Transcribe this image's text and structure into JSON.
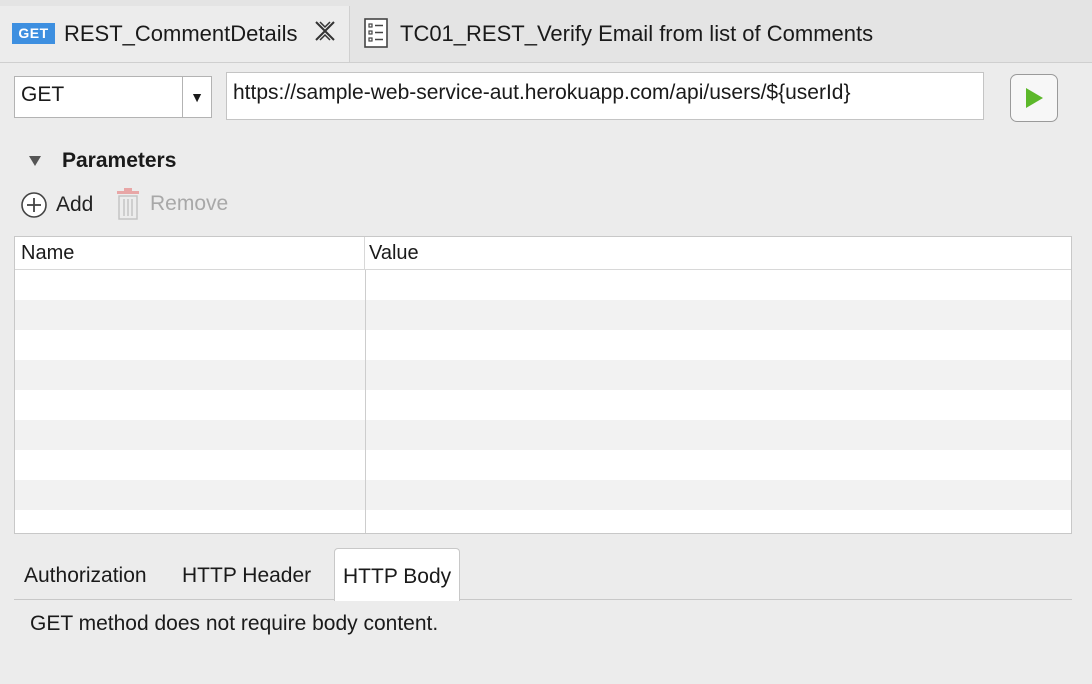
{
  "editor_tabs": [
    {
      "label": "REST_CommentDetails",
      "badge": "GET",
      "active": true,
      "icon": "get-method-icon"
    },
    {
      "label": "TC01_REST_Verify Email from list of Comments",
      "active": false,
      "icon": "test-case-icon"
    }
  ],
  "request": {
    "method": "GET",
    "url": "https://sample-web-service-aut.herokuapp.com/api/users/${userId}"
  },
  "parameters": {
    "title": "Parameters",
    "add_label": "Add",
    "remove_label": "Remove",
    "columns": [
      "Name",
      "Value"
    ],
    "rows": []
  },
  "lower_tabs": [
    "Authorization",
    "HTTP Header",
    "HTTP Body"
  ],
  "active_lower_tab": "HTTP Body",
  "body_message": "GET method does not require body content.",
  "colors": {
    "accent": "#3d8fe0",
    "run_green": "#5cb82a",
    "background": "#ececec"
  }
}
